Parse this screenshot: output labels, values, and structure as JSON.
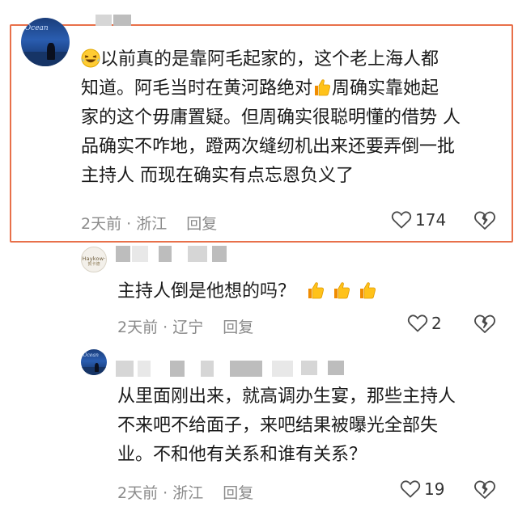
{
  "comments": [
    {
      "lines": [
        "以前真的是靠阿毛起家的，这个老上海人都",
        "知道。阿毛当时在黄河路绝对",
        "周确实靠她起",
        "家的这个毋庸置疑。但周确实很聪明懂的借势 人",
        "品确实不咋地，蹬两次缝纫机出来还要弄倒一批",
        "主持人 而现在确实有点忘恩负义了"
      ],
      "time_location": "2天前 · 浙江",
      "reply": "回复",
      "likes": "174"
    },
    {
      "text": "主持人倒是他想的吗？",
      "time_location": "2天前 · 辽宁",
      "reply": "回复",
      "likes": "2",
      "avatar_brand": "Haykow·",
      "avatar_brand_sub": "賀卡德"
    },
    {
      "lines": [
        "从里面刚出来，就高调办生宴，那些主持人",
        "不来吧不给面子，来吧结果被曝光全部失",
        "业。不和他有关系和谁有关系？"
      ],
      "time_location": "2天前 · 浙江",
      "reply": "回复",
      "likes": "19"
    }
  ],
  "icons": {
    "emoji_laugh": "grinning-squinting-emoji-icon",
    "emoji_thumb": "thumbs-up-emoji-icon",
    "like": "heart-outline-icon",
    "dislike": "broken-heart-icon"
  },
  "colors": {
    "highlight": "#e8704a",
    "meta": "#8a8a8a",
    "thumb": "#f7b500"
  }
}
